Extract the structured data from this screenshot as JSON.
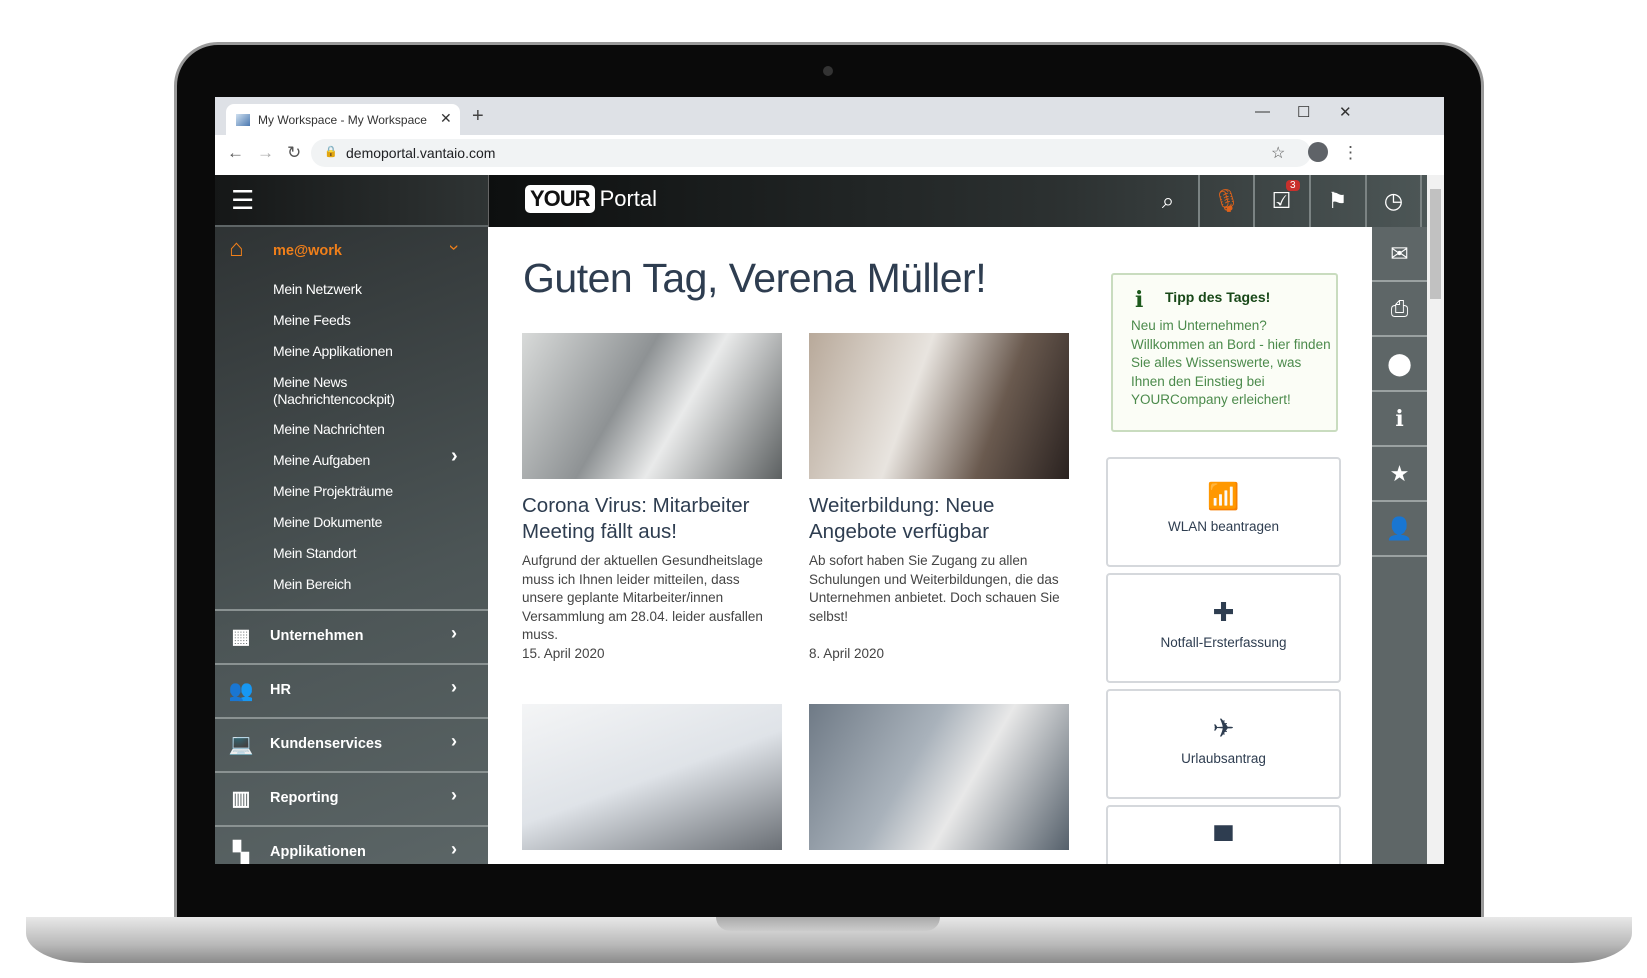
{
  "browser": {
    "tab_title": "My Workspace - My Workspace",
    "url": "demoportal.vantaio.com"
  },
  "header": {
    "logo_your": "YOUR",
    "logo_portal": "Portal",
    "task_badge": "3"
  },
  "sidebar": {
    "group": {
      "label": "me@work",
      "items": [
        "Mein Netzwerk",
        "Meine Feeds",
        "Meine Applikationen",
        "Meine News (Nachrichtencockpit)",
        "Meine Nachrichten",
        "Meine Aufgaben",
        "Meine Projekträume",
        "Meine Dokumente",
        "Mein Standort",
        "Mein Bereich"
      ]
    },
    "sections": [
      "Unternehmen",
      "HR",
      "Kundenservices",
      "Reporting",
      "Applikationen"
    ]
  },
  "main": {
    "greeting": "Guten Tag, Verena Müller!",
    "news": [
      {
        "title": "Corona Virus: Mitarbeiter Meeting fällt aus!",
        "body": "Aufgrund der aktuellen Gesundheitslage muss ich Ihnen leider mitteilen, dass unsere geplante Mitarbeiter/innen Versammlung am 28.04. leider ausfallen muss.",
        "date": "15. April 2020"
      },
      {
        "title": "Weiterbildung: Neue Angebote verfügbar",
        "body": "Ab sofort haben Sie Zugang zu allen Schulungen und Weiterbildungen, die das Unternehmen anbietet. Doch schauen Sie selbst!",
        "date": "8. April 2020"
      }
    ],
    "tip": {
      "title": "Tipp des Tages!",
      "body": "Neu im Unternehmen? Willkommen an Bord - hier finden Sie alles Wissenswerte, was Ihnen den Einstieg bei YOURCompany erleichert!"
    },
    "tiles": [
      {
        "label": "WLAN beantragen",
        "icon": "wifi-icon"
      },
      {
        "label": "Notfall-Ersterfassung",
        "icon": "first-aid-icon"
      },
      {
        "label": "Urlaubsantrag",
        "icon": "plane-icon"
      }
    ]
  },
  "colors": {
    "accent": "#f07f1a",
    "text": "#2e3d50",
    "tip_green": "#4b8a4b"
  }
}
